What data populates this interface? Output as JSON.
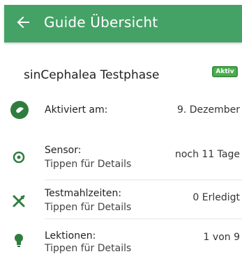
{
  "appbar": {
    "title": "Guide Übersicht",
    "back_icon": "arrow-left-icon",
    "color": "#45a266"
  },
  "header": {
    "title": "sinCephalea Testphase",
    "badge": "Aktiv",
    "badge_color": "#4caf50"
  },
  "rows": [
    {
      "icon": "activation-dot-icon",
      "label": "Aktiviert am:",
      "sub": "",
      "value": "9. Dezember"
    },
    {
      "icon": "sensor-icon",
      "label": "Sensor:",
      "sub": "Tippen für Details",
      "value": "noch 11 Tage"
    },
    {
      "icon": "cutlery-icon",
      "label": "Testmahlzeiten:",
      "sub": "Tippen für Details",
      "value": "0 Erledigt"
    },
    {
      "icon": "lightbulb-icon",
      "label": "Lektionen:",
      "sub": "Tippen für Details",
      "value": "1 von 9"
    }
  ]
}
